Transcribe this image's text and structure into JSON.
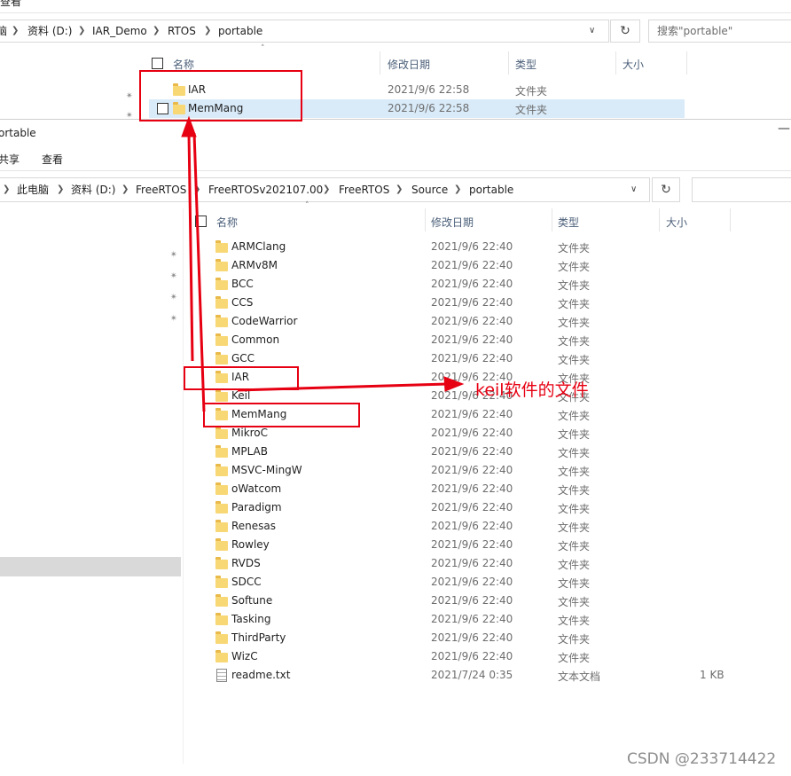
{
  "back_window": {
    "menu_view": "查看",
    "breadcrumb": [
      "脑",
      "资料 (D:)",
      "IAR_Demo",
      "RTOS",
      "portable"
    ],
    "search_placeholder": "搜索\"portable\"",
    "columns": {
      "name": "名称",
      "date": "修改日期",
      "type": "类型",
      "size": "大小"
    },
    "rows": [
      {
        "name": "IAR",
        "date": "2021/9/6 22:58",
        "type": "文件夹"
      },
      {
        "name": "MemMang",
        "date": "2021/9/6 22:58",
        "type": "文件夹"
      }
    ]
  },
  "front_window": {
    "title": "ortable",
    "menu": [
      "共享",
      "查看"
    ],
    "breadcrumb": [
      "此电脑",
      "资料 (D:)",
      "FreeRTOS",
      "FreeRTOSv202107.00",
      "FreeRTOS",
      "Source",
      "portable"
    ],
    "columns": {
      "name": "名称",
      "date": "修改日期",
      "type": "类型",
      "size": "大小"
    },
    "rows": [
      {
        "name": "ARMClang",
        "date": "2021/9/6 22:40",
        "type": "文件夹",
        "size": ""
      },
      {
        "name": "ARMv8M",
        "date": "2021/9/6 22:40",
        "type": "文件夹",
        "size": ""
      },
      {
        "name": "BCC",
        "date": "2021/9/6 22:40",
        "type": "文件夹",
        "size": ""
      },
      {
        "name": "CCS",
        "date": "2021/9/6 22:40",
        "type": "文件夹",
        "size": ""
      },
      {
        "name": "CodeWarrior",
        "date": "2021/9/6 22:40",
        "type": "文件夹",
        "size": ""
      },
      {
        "name": "Common",
        "date": "2021/9/6 22:40",
        "type": "文件夹",
        "size": ""
      },
      {
        "name": "GCC",
        "date": "2021/9/6 22:40",
        "type": "文件夹",
        "size": ""
      },
      {
        "name": "IAR",
        "date": "2021/9/6 22:40",
        "type": "文件夹",
        "size": ""
      },
      {
        "name": "Keil",
        "date": "2021/9/6 22:40",
        "type": "文件夹",
        "size": ""
      },
      {
        "name": "MemMang",
        "date": "2021/9/6 22:40",
        "type": "文件夹",
        "size": ""
      },
      {
        "name": "MikroC",
        "date": "2021/9/6 22:40",
        "type": "文件夹",
        "size": ""
      },
      {
        "name": "MPLAB",
        "date": "2021/9/6 22:40",
        "type": "文件夹",
        "size": ""
      },
      {
        "name": "MSVC-MingW",
        "date": "2021/9/6 22:40",
        "type": "文件夹",
        "size": ""
      },
      {
        "name": "oWatcom",
        "date": "2021/9/6 22:40",
        "type": "文件夹",
        "size": ""
      },
      {
        "name": "Paradigm",
        "date": "2021/9/6 22:40",
        "type": "文件夹",
        "size": ""
      },
      {
        "name": "Renesas",
        "date": "2021/9/6 22:40",
        "type": "文件夹",
        "size": ""
      },
      {
        "name": "Rowley",
        "date": "2021/9/6 22:40",
        "type": "文件夹",
        "size": ""
      },
      {
        "name": "RVDS",
        "date": "2021/9/6 22:40",
        "type": "文件夹",
        "size": ""
      },
      {
        "name": "SDCC",
        "date": "2021/9/6 22:40",
        "type": "文件夹",
        "size": ""
      },
      {
        "name": "Softune",
        "date": "2021/9/6 22:40",
        "type": "文件夹",
        "size": ""
      },
      {
        "name": "Tasking",
        "date": "2021/9/6 22:40",
        "type": "文件夹",
        "size": ""
      },
      {
        "name": "ThirdParty",
        "date": "2021/9/6 22:40",
        "type": "文件夹",
        "size": ""
      },
      {
        "name": "WizC",
        "date": "2021/9/6 22:40",
        "type": "文件夹",
        "size": ""
      },
      {
        "name": "readme.txt",
        "date": "2021/7/24 0:35",
        "type": "文本文档",
        "size": "1 KB",
        "is_file": true
      }
    ]
  },
  "annotation": {
    "text": "keil软件的文件",
    "color": "#e60012"
  },
  "watermark": "CSDN @233714422"
}
